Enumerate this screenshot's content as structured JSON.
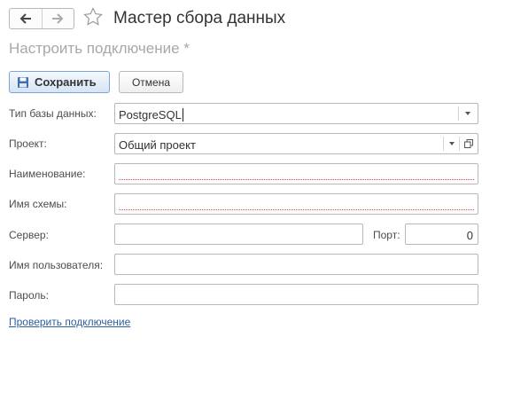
{
  "window": {
    "title": "Мастер сбора данных",
    "subtitle": "Настроить подключение *"
  },
  "toolbar": {
    "save_label": "Сохранить",
    "cancel_label": "Отмена"
  },
  "form": {
    "db_type": {
      "label": "Тип базы данных:",
      "value": "PostgreSQL"
    },
    "project": {
      "label": "Проект:",
      "value": "Общий проект"
    },
    "name": {
      "label": "Наименование:",
      "value": ""
    },
    "schema": {
      "label": "Имя схемы:",
      "value": ""
    },
    "server": {
      "label": "Сервер:",
      "value": ""
    },
    "port": {
      "label": "Порт:",
      "value": "0"
    },
    "user": {
      "label": "Имя пользователя:",
      "value": ""
    },
    "password": {
      "label": "Пароль:",
      "value": ""
    }
  },
  "check_link": "Проверить подключение",
  "icons": [
    "back-arrow-icon",
    "forward-arrow-icon",
    "favorite-star-icon",
    "save-disk-icon",
    "dropdown-caret-icon",
    "open-form-icon"
  ],
  "colors": {
    "accent_link": "#2c5f9e",
    "required_underline": "#d04a4a",
    "save_button_border": "#7ea6d4"
  }
}
